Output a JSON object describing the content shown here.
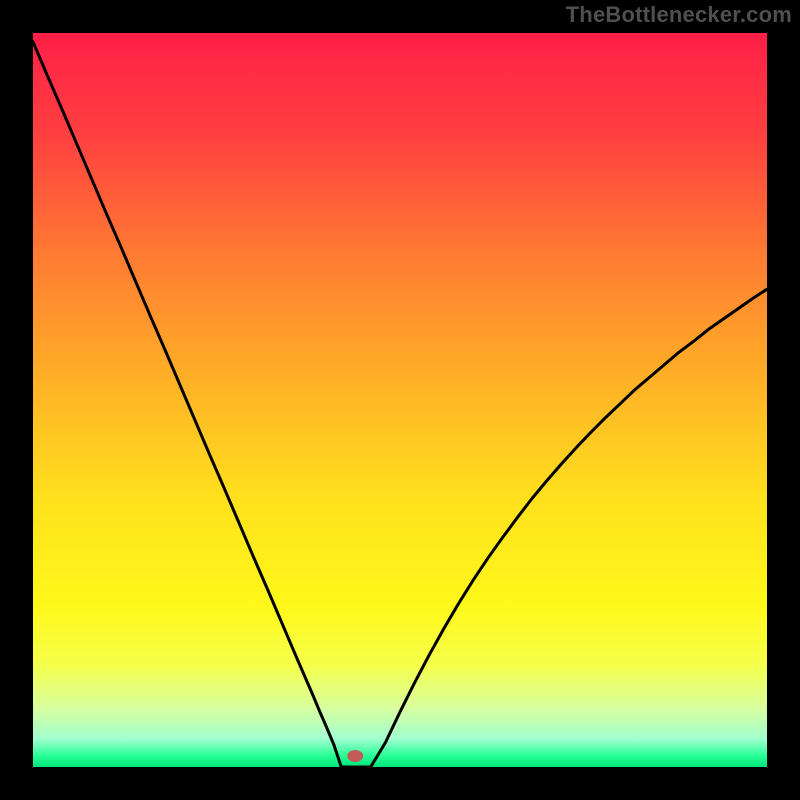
{
  "attribution": "TheBottlenecker.com",
  "chart_data": {
    "type": "line",
    "title": "",
    "xlabel": "",
    "ylabel": "",
    "xlim": [
      0,
      100
    ],
    "ylim": [
      0,
      100
    ],
    "x": [
      0,
      2,
      4,
      6,
      8,
      10,
      12,
      14,
      16,
      18,
      20,
      22,
      24,
      26,
      28,
      30,
      32,
      34,
      36,
      38,
      39,
      40,
      41,
      42,
      43,
      44,
      45,
      46,
      48,
      50,
      52,
      54,
      56,
      58,
      60,
      62,
      64,
      66,
      68,
      70,
      72,
      74,
      76,
      78,
      80,
      82,
      84,
      86,
      88,
      90,
      92,
      94,
      96,
      98,
      100
    ],
    "values": [
      98.8,
      94.1,
      89.5,
      84.8,
      80.1,
      75.4,
      70.8,
      66.1,
      61.4,
      56.8,
      52.1,
      47.4,
      42.7,
      38.1,
      33.4,
      28.7,
      24.1,
      19.4,
      14.7,
      10.1,
      7.7,
      5.4,
      3.0,
      0.0,
      0.0,
      0.0,
      0.0,
      0.0,
      3.3,
      7.5,
      11.5,
      15.3,
      18.9,
      22.3,
      25.5,
      28.5,
      31.3,
      34.0,
      36.6,
      39.0,
      41.3,
      43.5,
      45.6,
      47.6,
      49.5,
      51.4,
      53.1,
      54.8,
      56.5,
      58.0,
      59.6,
      61.0,
      62.4,
      63.8,
      65.1
    ],
    "marker": {
      "x": 43.9,
      "y": 1.5
    },
    "gradient_stops": [
      {
        "t": 0.0,
        "color": "#ff1f47"
      },
      {
        "t": 0.14,
        "color": "#ff4040"
      },
      {
        "t": 0.3,
        "color": "#ff7a33"
      },
      {
        "t": 0.48,
        "color": "#ffb326"
      },
      {
        "t": 0.64,
        "color": "#ffe21d"
      },
      {
        "t": 0.78,
        "color": "#fff81a"
      },
      {
        "t": 0.86,
        "color": "#f6ff4a"
      },
      {
        "t": 0.92,
        "color": "#d8ffa0"
      },
      {
        "t": 0.962,
        "color": "#a0ffd0"
      },
      {
        "t": 0.985,
        "color": "#25ff94"
      },
      {
        "t": 1.0,
        "color": "#00e47a"
      }
    ]
  }
}
